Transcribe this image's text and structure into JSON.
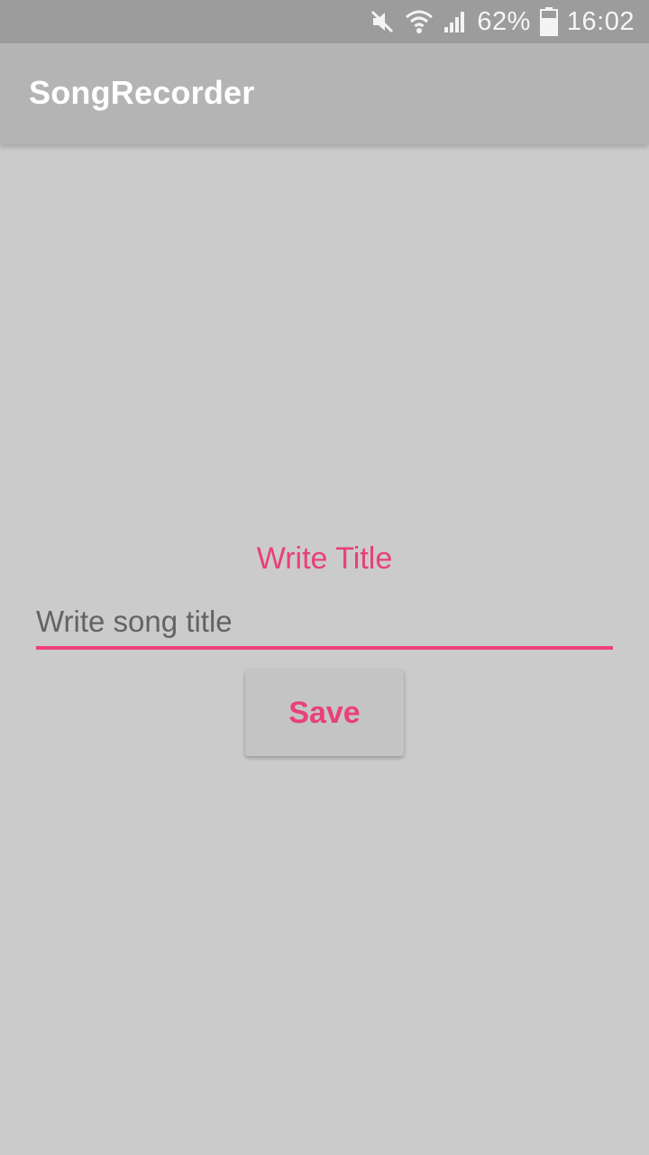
{
  "status_bar": {
    "battery": "62%",
    "time": "16:02",
    "icons": [
      "mute-icon",
      "wifi-icon",
      "signal-icon",
      "battery-icon"
    ]
  },
  "app_bar": {
    "title": "SongRecorder"
  },
  "form": {
    "label": "Write Title",
    "input_value": "",
    "input_placeholder": "Write song title",
    "save_label": "Save"
  },
  "colors": {
    "accent": "#e8407a",
    "background": "#cbcbcb",
    "app_bar": "#b4b4b4",
    "status_bar": "#9c9c9c"
  }
}
